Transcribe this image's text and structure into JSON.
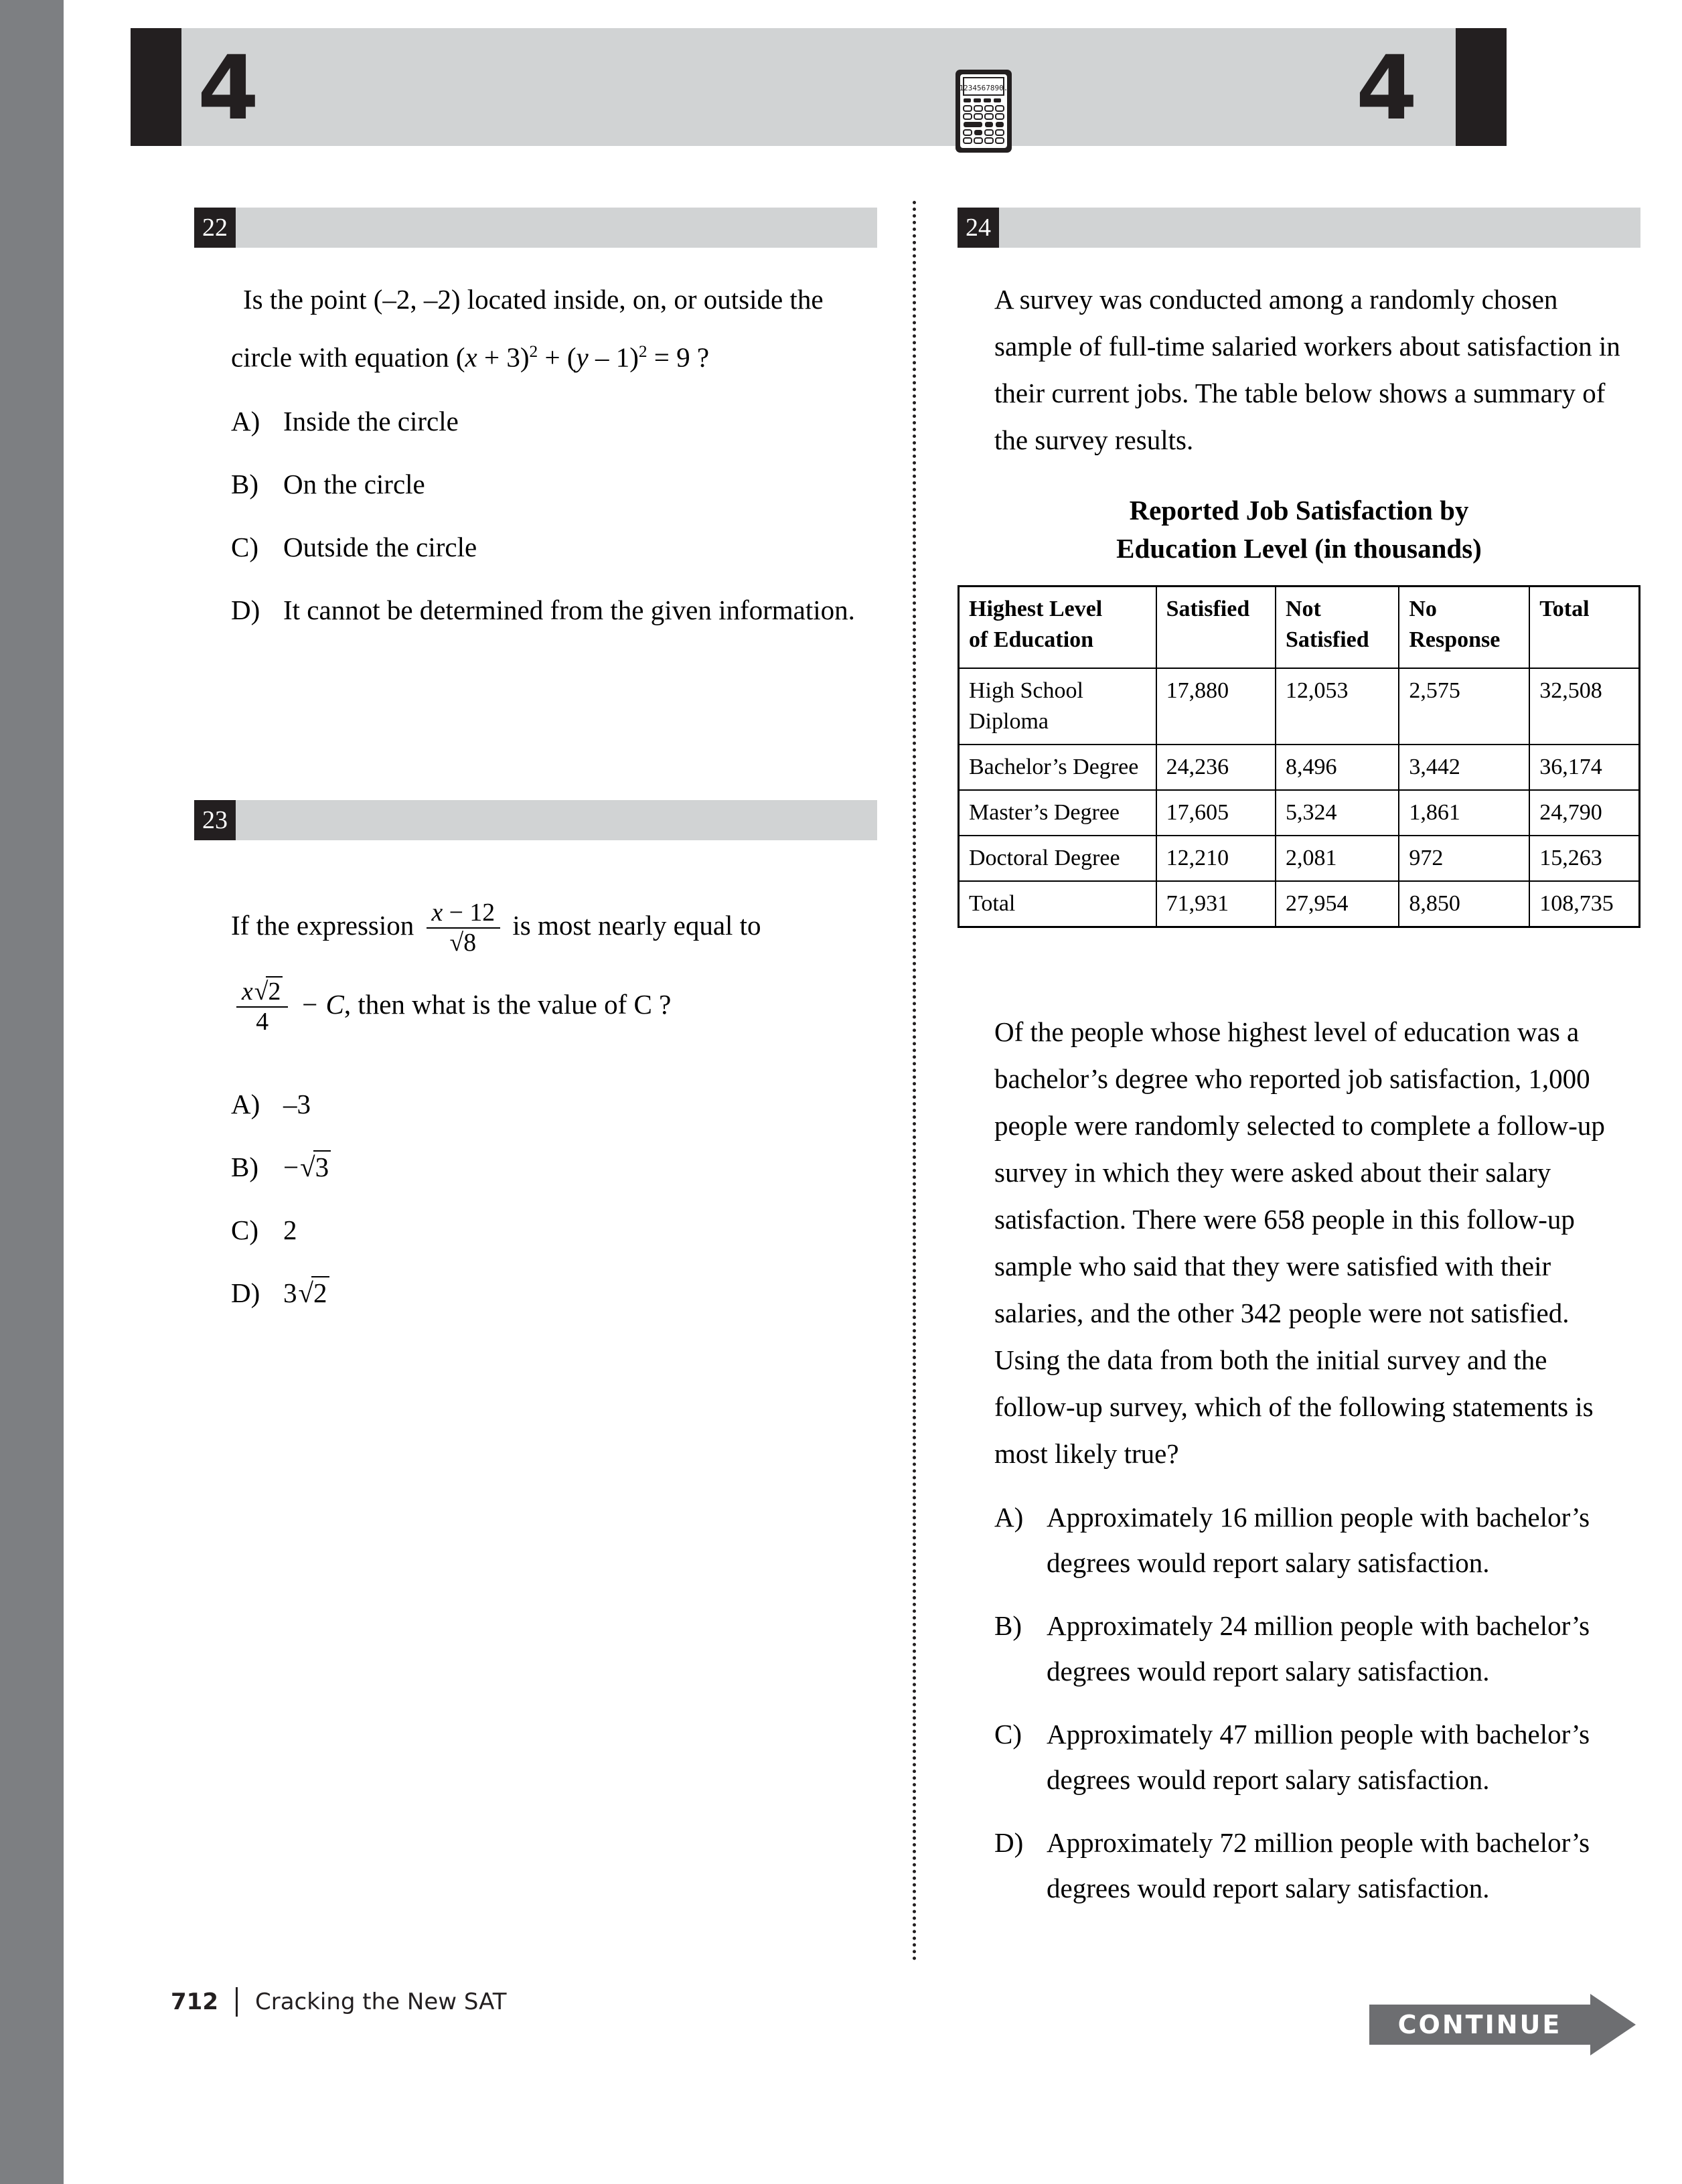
{
  "header": {
    "section_number_left": "4",
    "section_number_right": "4",
    "calculator_icon_display": "1234567890."
  },
  "questions": [
    {
      "number": "22",
      "prompt_line1_pre": "Is the point (–2, –2) located inside, on, or outside the",
      "prompt_line2_pre": "circle with equation (",
      "prompt_x": "x",
      "prompt_mid1": " + 3)",
      "prompt_pow1": "2",
      "prompt_mid2": " + (",
      "prompt_y": "y",
      "prompt_mid3": " – 1)",
      "prompt_pow2": "2",
      "prompt_end": " = 9 ?",
      "choices": [
        {
          "letter": "A)",
          "text": "Inside the circle"
        },
        {
          "letter": "B)",
          "text": "On the circle"
        },
        {
          "letter": "C)",
          "text": "Outside the circle"
        },
        {
          "letter": "D)",
          "text": "It cannot be determined from the given information."
        }
      ]
    },
    {
      "number": "23",
      "lead_text": "If the expression",
      "frac1_num_x": "x",
      "frac1_num_rest": " − 12",
      "frac1_den_radicand": "8",
      "mid_text": "is most nearly equal to",
      "frac2_num_x": "x",
      "frac2_num_radicand": "2",
      "frac2_den": "4",
      "minus_c": "− C",
      "tail_text": ", then what is the value of C ?",
      "choices": [
        {
          "letter": "A)",
          "text": "–3",
          "kind": "plain"
        },
        {
          "letter": "B)",
          "text": "−√3",
          "kind": "radical",
          "coef": "−",
          "radicand": "3"
        },
        {
          "letter": "C)",
          "text": "2",
          "kind": "plain"
        },
        {
          "letter": "D)",
          "text": "3√2",
          "kind": "radical",
          "coef": "3",
          "radicand": "2"
        }
      ]
    },
    {
      "number": "24",
      "intro": "A survey was conducted among a randomly chosen sample of full-time salaried workers about satisfaction in their current jobs. The table below shows a summary of the survey results.",
      "table_title_line1": "Reported Job Satisfaction by",
      "table_title_line2": "Education Level (in thousands)",
      "body": "Of the people whose highest level of education was a bachelor’s degree who reported job satisfaction, 1,000 people were randomly selected to complete a follow-up survey in which they were asked about their salary satisfaction. There were 658 people in this follow-up sample who said that they were satisfied with their salaries, and the other 342 people were not satisfied. Using the data from both the initial survey and the follow-up survey, which of the following statements is most likely true?",
      "choices": [
        {
          "letter": "A)",
          "text": "Approximately 16 million people with bachelor’s degrees would report salary satisfaction."
        },
        {
          "letter": "B)",
          "text": "Approximately 24 million people with bachelor’s degrees would report salary satisfaction."
        },
        {
          "letter": "C)",
          "text": "Approximately 47 million people with bachelor’s degrees would report salary satisfaction."
        },
        {
          "letter": "D)",
          "text": "Approximately 72 million people with bachelor’s degrees would report salary satisfaction."
        }
      ]
    }
  ],
  "chart_data": {
    "type": "table",
    "title": "Reported Job Satisfaction by Education Level (in thousands)",
    "columns": [
      "Highest Level of Education",
      "Satisfied",
      "Not Satisfied",
      "No Response",
      "Total"
    ],
    "column_header_lines": [
      [
        "Highest Level",
        "of Education"
      ],
      [
        "Satisfied",
        ""
      ],
      [
        "Not",
        "Satisfied"
      ],
      [
        "No",
        "Response"
      ],
      [
        "Total",
        ""
      ]
    ],
    "rows": [
      {
        "label": "High School Diploma",
        "satisfied": "17,880",
        "not_satisfied": "12,053",
        "no_response": "2,575",
        "total": "32,508"
      },
      {
        "label": "Bachelor’s Degree",
        "satisfied": "24,236",
        "not_satisfied": "8,496",
        "no_response": "3,442",
        "total": "36,174"
      },
      {
        "label": "Master’s Degree",
        "satisfied": "17,605",
        "not_satisfied": "5,324",
        "no_response": "1,861",
        "total": "24,790"
      },
      {
        "label": "Doctoral Degree",
        "satisfied": "12,210",
        "not_satisfied": "2,081",
        "no_response": "972",
        "total": "15,263"
      },
      {
        "label": "Total",
        "satisfied": "71,931",
        "not_satisfied": "27,954",
        "no_response": "8,850",
        "total": "108,735"
      }
    ],
    "units": "thousands"
  },
  "footer": {
    "page_number": "712",
    "book_title": "Cracking the New SAT",
    "continue_label": "CONTINUE"
  },
  "colors": {
    "band_gray": "#d1d3d4",
    "ink_black": "#231f20",
    "edge_gray": "#7d7f82",
    "continue_gray": "#6d6e71"
  }
}
